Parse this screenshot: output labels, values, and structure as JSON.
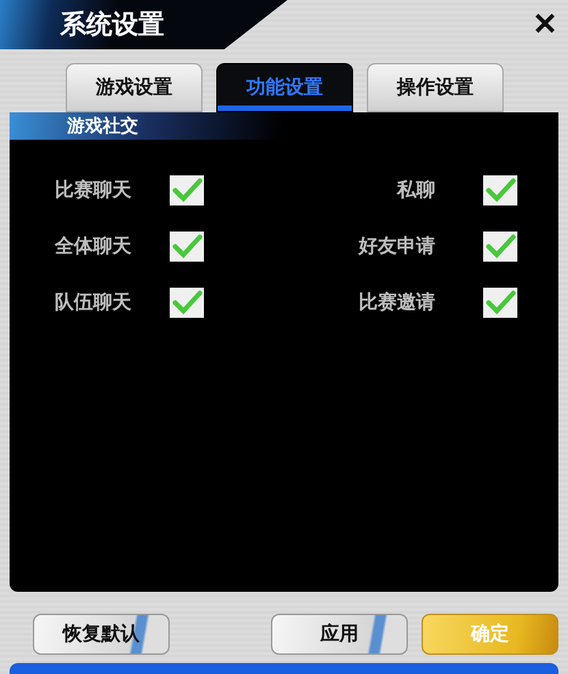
{
  "window": {
    "title": "系统设置",
    "close": "✕"
  },
  "tabs": [
    {
      "label": "游戏设置",
      "selected": false
    },
    {
      "label": "功能设置",
      "selected": true
    },
    {
      "label": "操作设置",
      "selected": false
    }
  ],
  "section": {
    "title": "游戏社交"
  },
  "options": [
    {
      "label": "比赛聊天",
      "checked": true
    },
    {
      "label": "私聊",
      "checked": true
    },
    {
      "label": "全体聊天",
      "checked": true
    },
    {
      "label": "好友申请",
      "checked": true
    },
    {
      "label": "队伍聊天",
      "checked": true
    },
    {
      "label": "比赛邀请",
      "checked": true
    }
  ],
  "buttons": [
    {
      "label": "恢复默认",
      "kind": "silver"
    },
    {
      "label": "应用",
      "kind": "silver"
    },
    {
      "label": "确定",
      "kind": "gold"
    }
  ]
}
